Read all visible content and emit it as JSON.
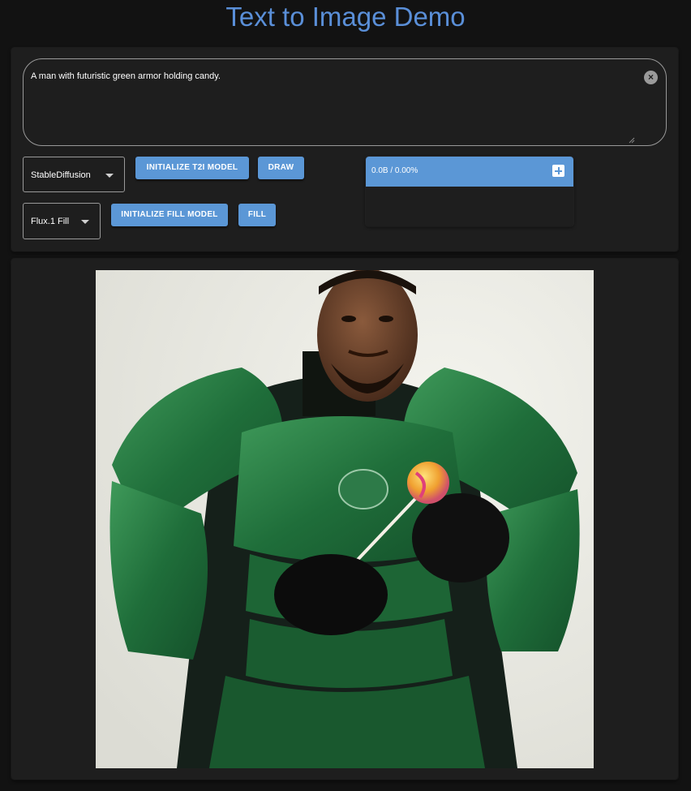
{
  "page": {
    "title": "Text to Image Demo"
  },
  "prompt": {
    "value": "A man with futuristic green armor holding candy.",
    "clear_icon": "close-circle-icon"
  },
  "controls": {
    "t2i_model_select": {
      "value": "StableDiffusion"
    },
    "init_t2i_label": "INITIALIZE T2I MODEL",
    "draw_label": "DRAW",
    "fill_model_select": {
      "value": "Flux.1 Fill"
    },
    "init_fill_label": "INITIALIZE FILL MODEL",
    "fill_label": "FILL"
  },
  "progress": {
    "text": "0.0B / 0.00%",
    "expand_icon": "plus-square-icon"
  },
  "output_image": {
    "description_icon": "generated-image",
    "subject": "man in green armor holding a lollipop"
  },
  "colors": {
    "accent": "#5b97d6",
    "title": "#5a8fd8",
    "background": "#121212",
    "panel": "#1e1e1e"
  }
}
